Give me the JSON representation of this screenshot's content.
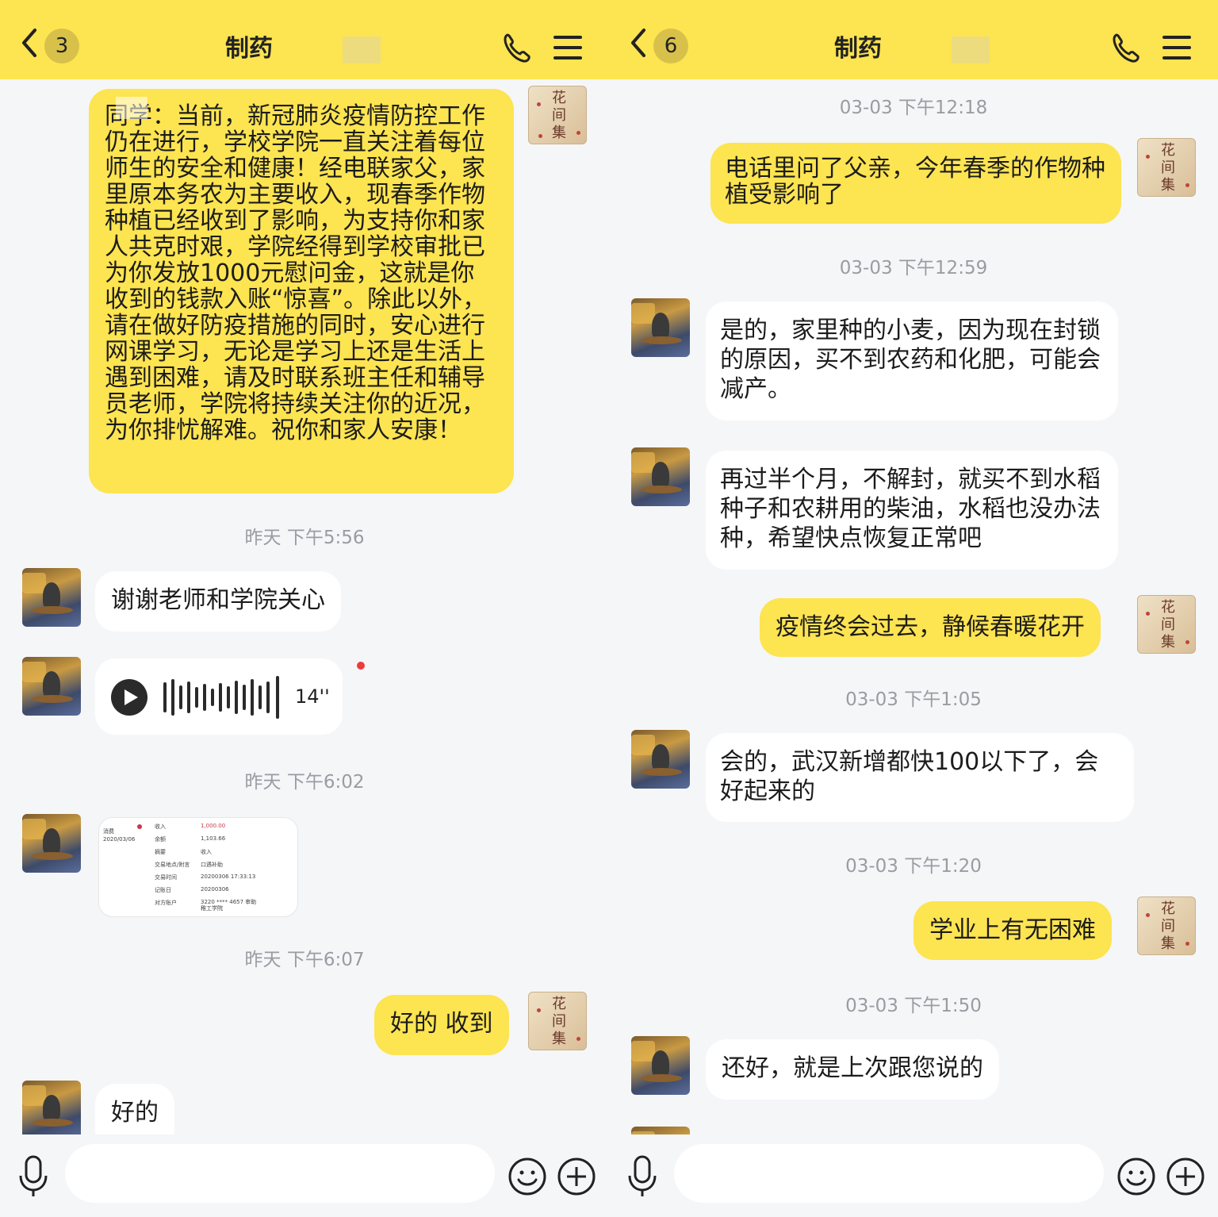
{
  "left": {
    "header": {
      "unread": "3",
      "title": "制药"
    },
    "messages": {
      "m1": "同学：当前，新冠肺炎疫情防控工作仍在进行，学校学院一直关注着每位师生的安全和健康！经电联家父，家里原本务农为主要收入，现春季作物种植已经收到了影响，为支持你和家人共克时艰，学院经得到学校审批已为你发放1000元慰问金，这就是你收到的钱款入账“惊喜”。除此以外，请在做好防疫措施的同时，安心进行网课学习，无论是学习上还是生活上遇到困难，请及时联系班主任和辅导员老师，学院将持续关注你的近况，为你排忧解难。祝你和家人安康！",
      "ts1": "昨天 下午5:56",
      "m2": "谢谢老师和学院关心",
      "voice_duration": "14''",
      "ts2": "昨天 下午6:02",
      "ts3": "昨天 下午6:07",
      "m3": "好的 收到",
      "m4": "好的"
    },
    "receipt": {
      "date": "消费\n2020/03/06",
      "rows": [
        {
          "k": "收入",
          "v": "1,000.00"
        },
        {
          "k": "余额",
          "v": "1,103.66"
        },
        {
          "k": "摘要",
          "v": "收入"
        },
        {
          "k": "交易地点/附言",
          "v": "口遇补助"
        },
        {
          "k": "交易时间",
          "v": "20200306 17:33:13"
        },
        {
          "k": "记账日",
          "v": "20200306"
        },
        {
          "k": "对方账户",
          "v": "3220 **** 4657 审助\n稚工学院"
        }
      ]
    }
  },
  "right": {
    "header": {
      "unread": "6",
      "title": "制药"
    },
    "messages": {
      "ts1": "03-03 下午12:18",
      "m1": "电话里问了父亲，今年春季的作物种植受影响了",
      "ts2": "03-03 下午12:59",
      "m2": "是的，家里种的小麦，因为现在封锁的原因，买不到农药和化肥，可能会减产。",
      "m3": "再过半个月，不解封，就买不到水稻种子和农耕用的柴油，水稻也没办法种，希望快点恢复正常吧",
      "m4": "疫情终会过去，静候春暖花开",
      "ts3": "03-03 下午1:05",
      "m5": "会的，武汉新增都快100以下了，会好起来的",
      "ts4": "03-03 下午1:20",
      "m6": "学业上有无困难",
      "ts5": "03-03 下午1:50",
      "m7": "还好，就是上次跟您说的"
    }
  },
  "avatar_seal_text": "花\n间\n集",
  "colors": {
    "accent": "#fde451",
    "bubble_white": "#ffffff",
    "background": "#f5f6f8",
    "timestamp": "#9a9ca3"
  },
  "icons": [
    "back-chevron-icon",
    "phone-icon",
    "menu-icon",
    "microphone-icon",
    "emoji-icon",
    "plus-icon",
    "play-icon"
  ]
}
